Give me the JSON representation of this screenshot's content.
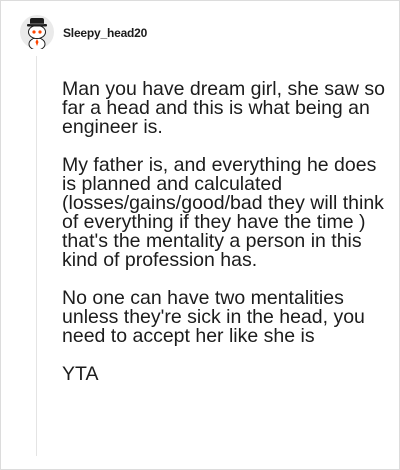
{
  "comment": {
    "author": "Sleepy_head20",
    "paragraphs": [
      "Man you have dream girl, she saw so far a head and this is what being an engineer is.",
      "My father is, and everything he does is planned and calculated (losses/gains/good/bad they will think of everything if they have the time ) that's the mentality a person in this kind of profession has.",
      "No one can have two mentalities unless they're sick in the head, you need to accept her like she is",
      "YTA"
    ]
  },
  "icons": {
    "avatar": "snoo-avatar-with-hat-icon"
  },
  "colors": {
    "text": "#1c1c1c",
    "thread_line": "#e4e4e4",
    "background": "#ffffff",
    "avatar_bg": "#eaeaea",
    "avatar_accent": "#ff4500"
  }
}
